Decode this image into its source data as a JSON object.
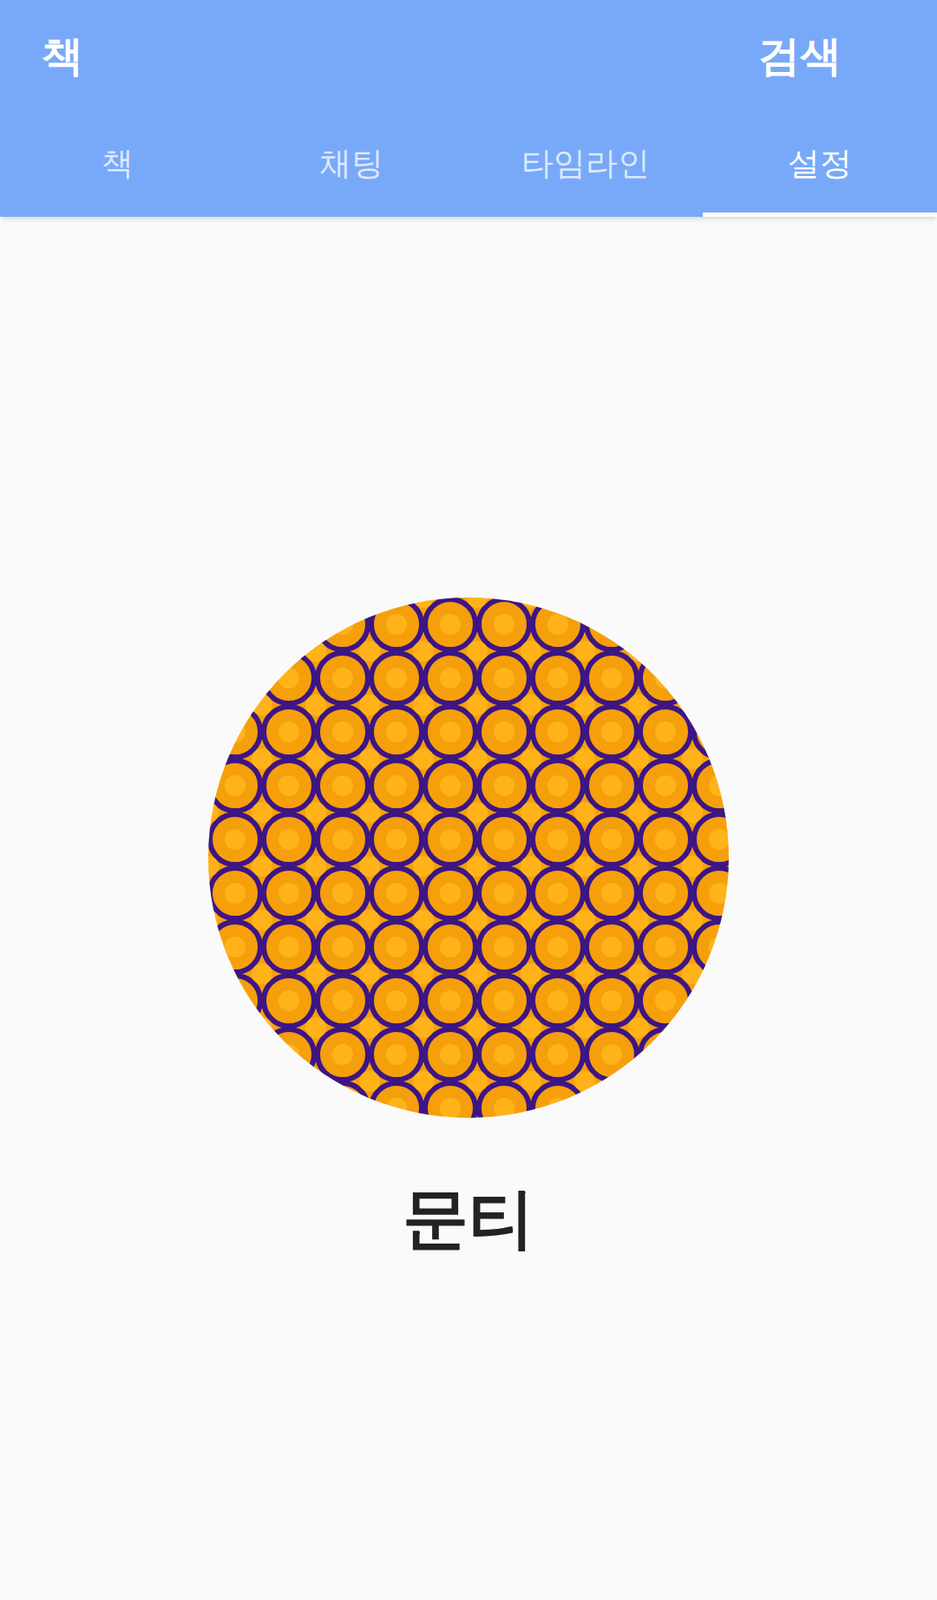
{
  "app_bar": {
    "title": "책",
    "action": "검색"
  },
  "tabs": [
    {
      "label": "책",
      "selected": false
    },
    {
      "label": "채팅",
      "selected": false
    },
    {
      "label": "타임라인",
      "selected": false
    },
    {
      "label": "설정",
      "selected": true
    }
  ],
  "profile": {
    "name": "문티"
  }
}
